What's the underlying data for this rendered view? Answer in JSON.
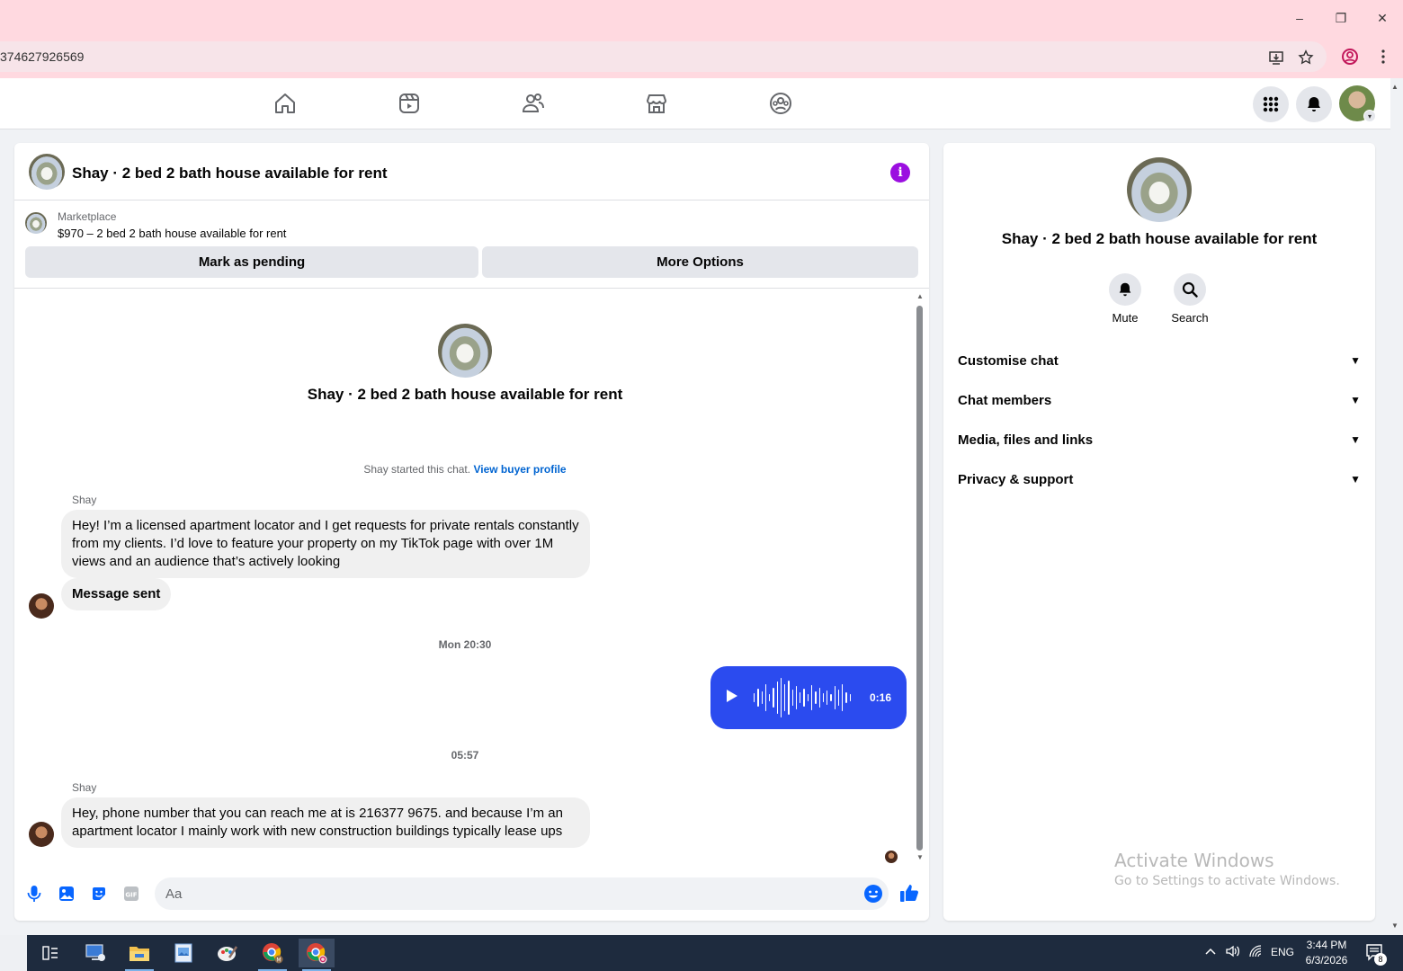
{
  "browser": {
    "url_fragment": "374627926569",
    "minimize": "–",
    "restore": "❐",
    "close": "✕"
  },
  "nav": {
    "icons": [
      "home-icon",
      "video-icon",
      "friends-icon",
      "marketplace-icon",
      "groups-icon"
    ]
  },
  "chat": {
    "title": "Shay · 2 bed 2 bath house available for rent",
    "marketplace_label": "Marketplace",
    "listing": "$970 – 2 bed 2 bath house available for rent",
    "mark_pending": "Mark as pending",
    "more_options": "More Options",
    "center_title": "Shay · 2 bed 2 bath house available for rent",
    "started_text": "Shay started this chat.",
    "view_buyer_profile": "View buyer profile",
    "messages": [
      {
        "sender": "Shay",
        "text": "Hey! I’m a licensed apartment locator and I get requests for private rentals constantly from my clients. I’d love to feature your property on my TikTok page with over 1M views and an audience that’s actively looking"
      },
      {
        "text": "Message sent"
      }
    ],
    "timestamp1": "Mon 20:30",
    "audio_duration": "0:16",
    "timestamp2": "05:57",
    "message2_sender": "Shay",
    "message2_text": "Hey, phone number that you can reach me at is 216377 9675. and because I’m an apartment locator I mainly work with new construction buildings typically lease ups",
    "composer_placeholder": "Aa"
  },
  "info_panel": {
    "title": "Shay · 2 bed 2 bath house available for rent",
    "actions": [
      {
        "label": "Mute",
        "icon": "bell-icon"
      },
      {
        "label": "Search",
        "icon": "search-icon"
      }
    ],
    "sections": [
      "Customise chat",
      "Chat members",
      "Media, files and links",
      "Privacy & support"
    ]
  },
  "watermark": {
    "line1": "Activate Windows",
    "line2": "Go to Settings to activate Windows."
  },
  "taskbar": {
    "lang": "ENG",
    "time": "3:44 PM",
    "date": "6/3/2026",
    "notifications": "8"
  },
  "colors": {
    "accent_blue": "#2b4bef",
    "link_blue": "#0064d1",
    "info_purple": "#9b0ee0",
    "titlebar_pink": "#ffd9e0"
  }
}
